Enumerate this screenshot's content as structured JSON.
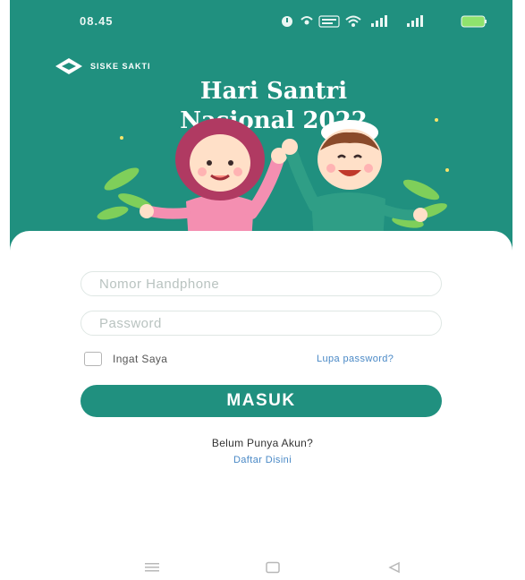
{
  "status_bar": {
    "time": "08.45",
    "icons": [
      "alarm-icon",
      "hotspot-icon",
      "data-speed-icon",
      "wifi-icon",
      "signal-icon",
      "signal-icon",
      "battery-icon"
    ]
  },
  "header": {
    "brand": "SISKE SAKTI",
    "title_line1": "Hari Santri",
    "title_line2": "Nasional 2022"
  },
  "login": {
    "phone_placeholder": "Nomor Handphone",
    "password_placeholder": "Password",
    "remember_label": "Ingat Saya",
    "forgot_label": "Lupa password?",
    "submit_label": "MASUK",
    "no_account_text": "Belum Punya Akun?",
    "register_label": "Daftar Disini"
  },
  "nav": {
    "icons": [
      "menu-icon",
      "home-icon",
      "back-icon"
    ]
  },
  "colors": {
    "primary": "#20907f",
    "link": "#4a89c6",
    "battery": "#8fe36d"
  }
}
